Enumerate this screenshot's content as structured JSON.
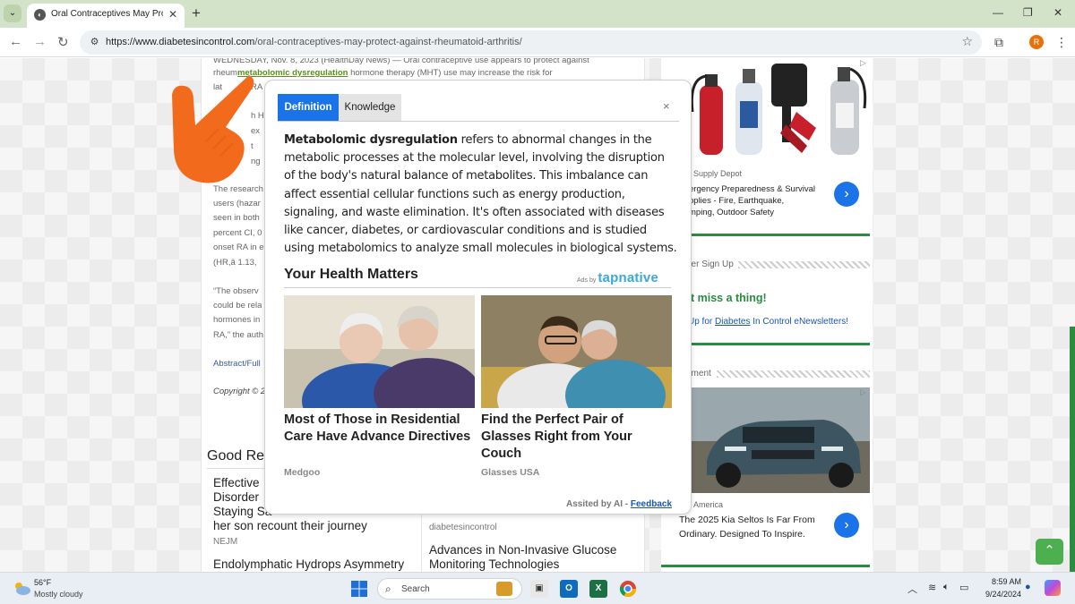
{
  "browser": {
    "tab_title": "Oral Contraceptives May Protect",
    "url_host": "https://www.diabetesincontrol.com",
    "url_path": "/oral-contraceptives-may-protect-against-rheumatoid-arthritis/",
    "profile_initial": "R"
  },
  "article": {
    "line1": "WEDNESDAY, Nov. 8, 2023 (HealthDay News) — Oral contraceptive use appears to protect against",
    "line2_pre": "rheum",
    "line2_link": "metabolomic dysregulation",
    "line2_post": " hormone therapy (MHT) use may increase the risk for",
    "line3": "lat",
    "line3b": "RA",
    "line4": "h Ha",
    "line5": "ex",
    "line6": "t",
    "line7": "ng",
    "para2": [
      "The research",
      "users (hazar",
      "seen in both",
      "percent CI, 0",
      "onset RA in e",
      "(HR,â    1.13,"
    ],
    "para3": [
      "“The observ",
      "could be rela",
      "hormones in",
      "RA,” the auth"
    ],
    "abstract_link": "Abstract/Full",
    "copyright": "Copyright © 2",
    "good_reads": "Good Re",
    "left_card_lines": [
      "Effective",
      "Disorder",
      "Staying Sa",
      "her son recount their journey"
    ],
    "left_card_source": "NEJM",
    "left_card2": "Endolymphatic Hydrops Asymmetry",
    "right_card_source": "diabetesincontrol",
    "right_card_lines": [
      "Advances in Non-Invasive Glucose",
      "Monitoring Technologies"
    ]
  },
  "sidebar": {
    "ad1_source": "Supply Depot",
    "ad1_lines": [
      "ergency Preparedness & Survival",
      "pplies - Fire, Earthquake,",
      "mping, Outdoor Safety"
    ],
    "newsletter_title": "tter Sign Up",
    "dont_miss": "'t miss a thing!",
    "signup_pre": "Up for ",
    "signup_link": "Diabetes",
    "signup_post": " In Control eNewsletters!",
    "ad2_title": "ement",
    "ad2_source": "America",
    "ad2_lines": [
      "The 2025 Kia Seltos Is Far From",
      "Ordinary. Designed To Inspire."
    ]
  },
  "popup": {
    "tab_definition": "Definition",
    "tab_knowledge": "Knowledge",
    "close": "×",
    "term": "Metabolomic dysregulation",
    "definition": " refers to abnormal changes in the metabolic processes at the molecular level, involving the disruption of the body's natural balance of metabolites. This imbalance can affect essential cellular functions such as energy production, signaling, and waste elimination. It's often associated with diseases like cancer, diabetes, or cardiovascular conditions and is studied using metabolomics to analyze small molecules in biological systems.",
    "section_title": "Your Health Matters",
    "ads_by": "Ads by",
    "ads_brand": "tapnative",
    "native_ads": [
      {
        "title": "Most of Those in Residential Care Have Advance Directives",
        "source": "Medgoo"
      },
      {
        "title": "Find the Perfect Pair of Glasses Right from Your Couch",
        "source": "Glasses USA"
      }
    ],
    "assisted": "Assited by AI - ",
    "feedback": "Feedback"
  },
  "taskbar": {
    "temp": "56°F",
    "weather": "Mostly cloudy",
    "search": "Search",
    "time": "8:59 AM",
    "date": "9/24/2024"
  },
  "colors": {
    "accent": "#1a73e8",
    "sidebar_green": "#2a8c3e",
    "cursor_orange": "#f26b1d"
  }
}
